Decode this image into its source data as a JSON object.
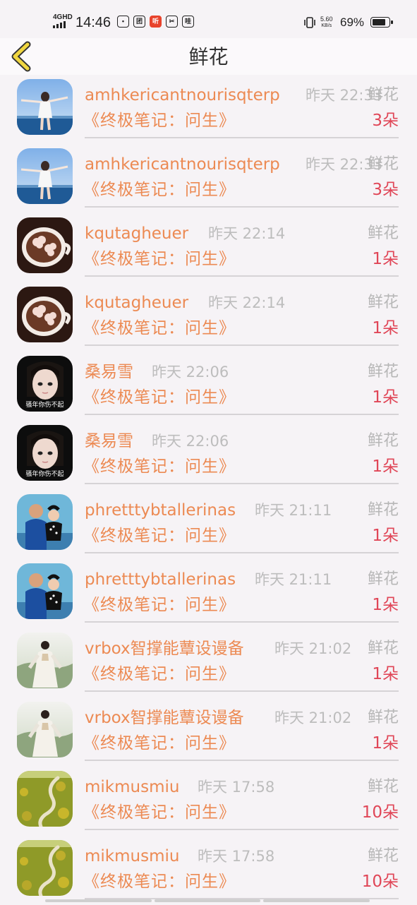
{
  "status_bar": {
    "network": "4GHD",
    "time": "14:46",
    "app_icons": [
      "团",
      "听",
      "✂",
      "哇"
    ],
    "speed_value": "5.60",
    "speed_unit": "KB/s",
    "battery_pct": "69%"
  },
  "header": {
    "title": "鲜花",
    "back_icon": "chevron-left-icon"
  },
  "colors": {
    "accent": "#ec8a53",
    "count_red": "#e04657",
    "muted": "#bdbdbd",
    "back_icon_fill": "#f0d640"
  },
  "records": [
    {
      "name": "amhkericantnourisqterp",
      "time": "昨天 22:33",
      "gift": "鲜花",
      "book": "《终极笔记：问生》",
      "count": "3朵",
      "avatar": "sea-girl"
    },
    {
      "name": "amhkericantnourisqterp",
      "time": "昨天 22:33",
      "gift": "鲜花",
      "book": "《终极笔记：问生》",
      "count": "3朵",
      "avatar": "sea-girl"
    },
    {
      "name": "kqutagheuer",
      "time": "昨天 22:14",
      "gift": "鲜花",
      "book": "《终极笔记：问生》",
      "count": "1朵",
      "avatar": "coffee"
    },
    {
      "name": "kqutagheuer",
      "time": "昨天 22:14",
      "gift": "鲜花",
      "book": "《终极笔记：问生》",
      "count": "1朵",
      "avatar": "coffee"
    },
    {
      "name": "桑易雪",
      "time": "昨天 22:06",
      "gift": "鲜花",
      "book": "《终极笔记：问生》",
      "count": "1朵",
      "avatar": "dark-girl"
    },
    {
      "name": "桑易雪",
      "time": "昨天 22:06",
      "gift": "鲜花",
      "book": "《终极笔记：问生》",
      "count": "1朵",
      "avatar": "dark-girl"
    },
    {
      "name": "phretttybtallerinas",
      "time": "昨天 21:11",
      "gift": "鲜花",
      "book": "《终极笔记：问生》",
      "count": "1朵",
      "avatar": "family"
    },
    {
      "name": "phretttybtallerinas",
      "time": "昨天 21:11",
      "gift": "鲜花",
      "book": "《终极笔记：问生》",
      "count": "1朵",
      "avatar": "family"
    },
    {
      "name": "vrbox智撑能蕈设谩备",
      "time": "昨天 21:02",
      "gift": "鲜花",
      "book": "《终极笔记：问生》",
      "count": "1朵",
      "avatar": "hanfu-girl"
    },
    {
      "name": "vrbox智撑能蕈设谩备",
      "time": "昨天 21:02",
      "gift": "鲜花",
      "book": "《终极笔记：问生》",
      "count": "1朵",
      "avatar": "hanfu-girl"
    },
    {
      "name": "mikmusmiu",
      "time": "昨天 17:58",
      "gift": "鲜花",
      "book": "《终极笔记：问生》",
      "count": "10朵",
      "avatar": "field-path"
    },
    {
      "name": "mikmusmiu",
      "time": "昨天 17:58",
      "gift": "鲜花",
      "book": "《终极笔记：问生》",
      "count": "10朵",
      "avatar": "field-path"
    }
  ],
  "avatar_caption": "骚年你伤不起"
}
